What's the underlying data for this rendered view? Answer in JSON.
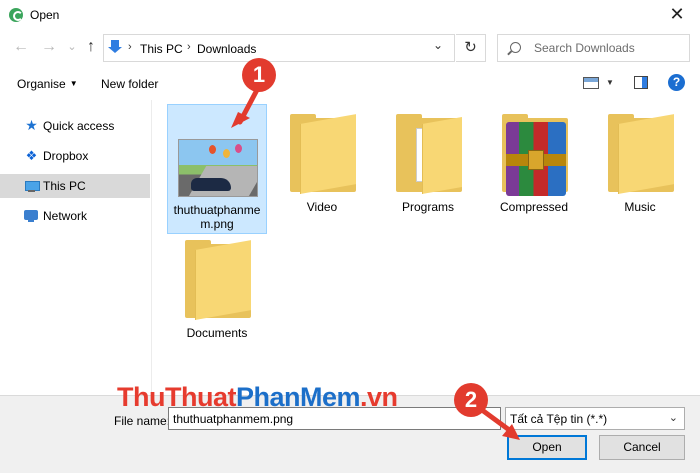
{
  "window": {
    "title": "Open",
    "close_glyph": "✕"
  },
  "nav": {
    "back_glyph": "←",
    "forward_glyph": "→",
    "recent_glyph": "⌄",
    "up_glyph": "↑"
  },
  "address": {
    "breadcrumbs": [
      "This PC",
      "Downloads"
    ],
    "separator": "›",
    "dropdown_glyph": "⌄",
    "refresh_glyph": "↻"
  },
  "search": {
    "placeholder": "Search Downloads"
  },
  "toolbar": {
    "organise_label": "Organise",
    "organise_caret": "▼",
    "new_folder_label": "New folder",
    "view_caret": "▼",
    "help_glyph": "?"
  },
  "sidebar": {
    "items": [
      {
        "label": "Quick access",
        "icon": "star-icon",
        "glyph": "★"
      },
      {
        "label": "Dropbox",
        "icon": "dropbox-icon",
        "glyph": "❖"
      },
      {
        "label": "This PC",
        "icon": "pc-icon",
        "glyph": ""
      },
      {
        "label": "Network",
        "icon": "network-icon",
        "glyph": ""
      }
    ],
    "selected": "This PC"
  },
  "files": [
    {
      "name_line1": "thuthuatphanme",
      "name_line2": "m.png",
      "type": "image",
      "selected": true
    },
    {
      "name": "Video",
      "type": "folder"
    },
    {
      "name": "Programs",
      "type": "folder-documents"
    },
    {
      "name": "Compressed",
      "type": "archive"
    },
    {
      "name": "Music",
      "type": "folder"
    },
    {
      "name": "Documents",
      "type": "folder"
    }
  ],
  "bottom": {
    "file_name_label": "File name:",
    "file_name_value": "thuthuatphanmem.png",
    "file_type_value": "Tất cả Tệp tin (*.*)",
    "file_type_caret": "⌄",
    "open_label": "Open",
    "cancel_label": "Cancel"
  },
  "watermark": {
    "part_a": "ThuThuat",
    "part_b": "PhanMem",
    "part_c": ".vn"
  },
  "annotations": {
    "step1": "1",
    "step2": "2",
    "color": "#e23b2e"
  }
}
